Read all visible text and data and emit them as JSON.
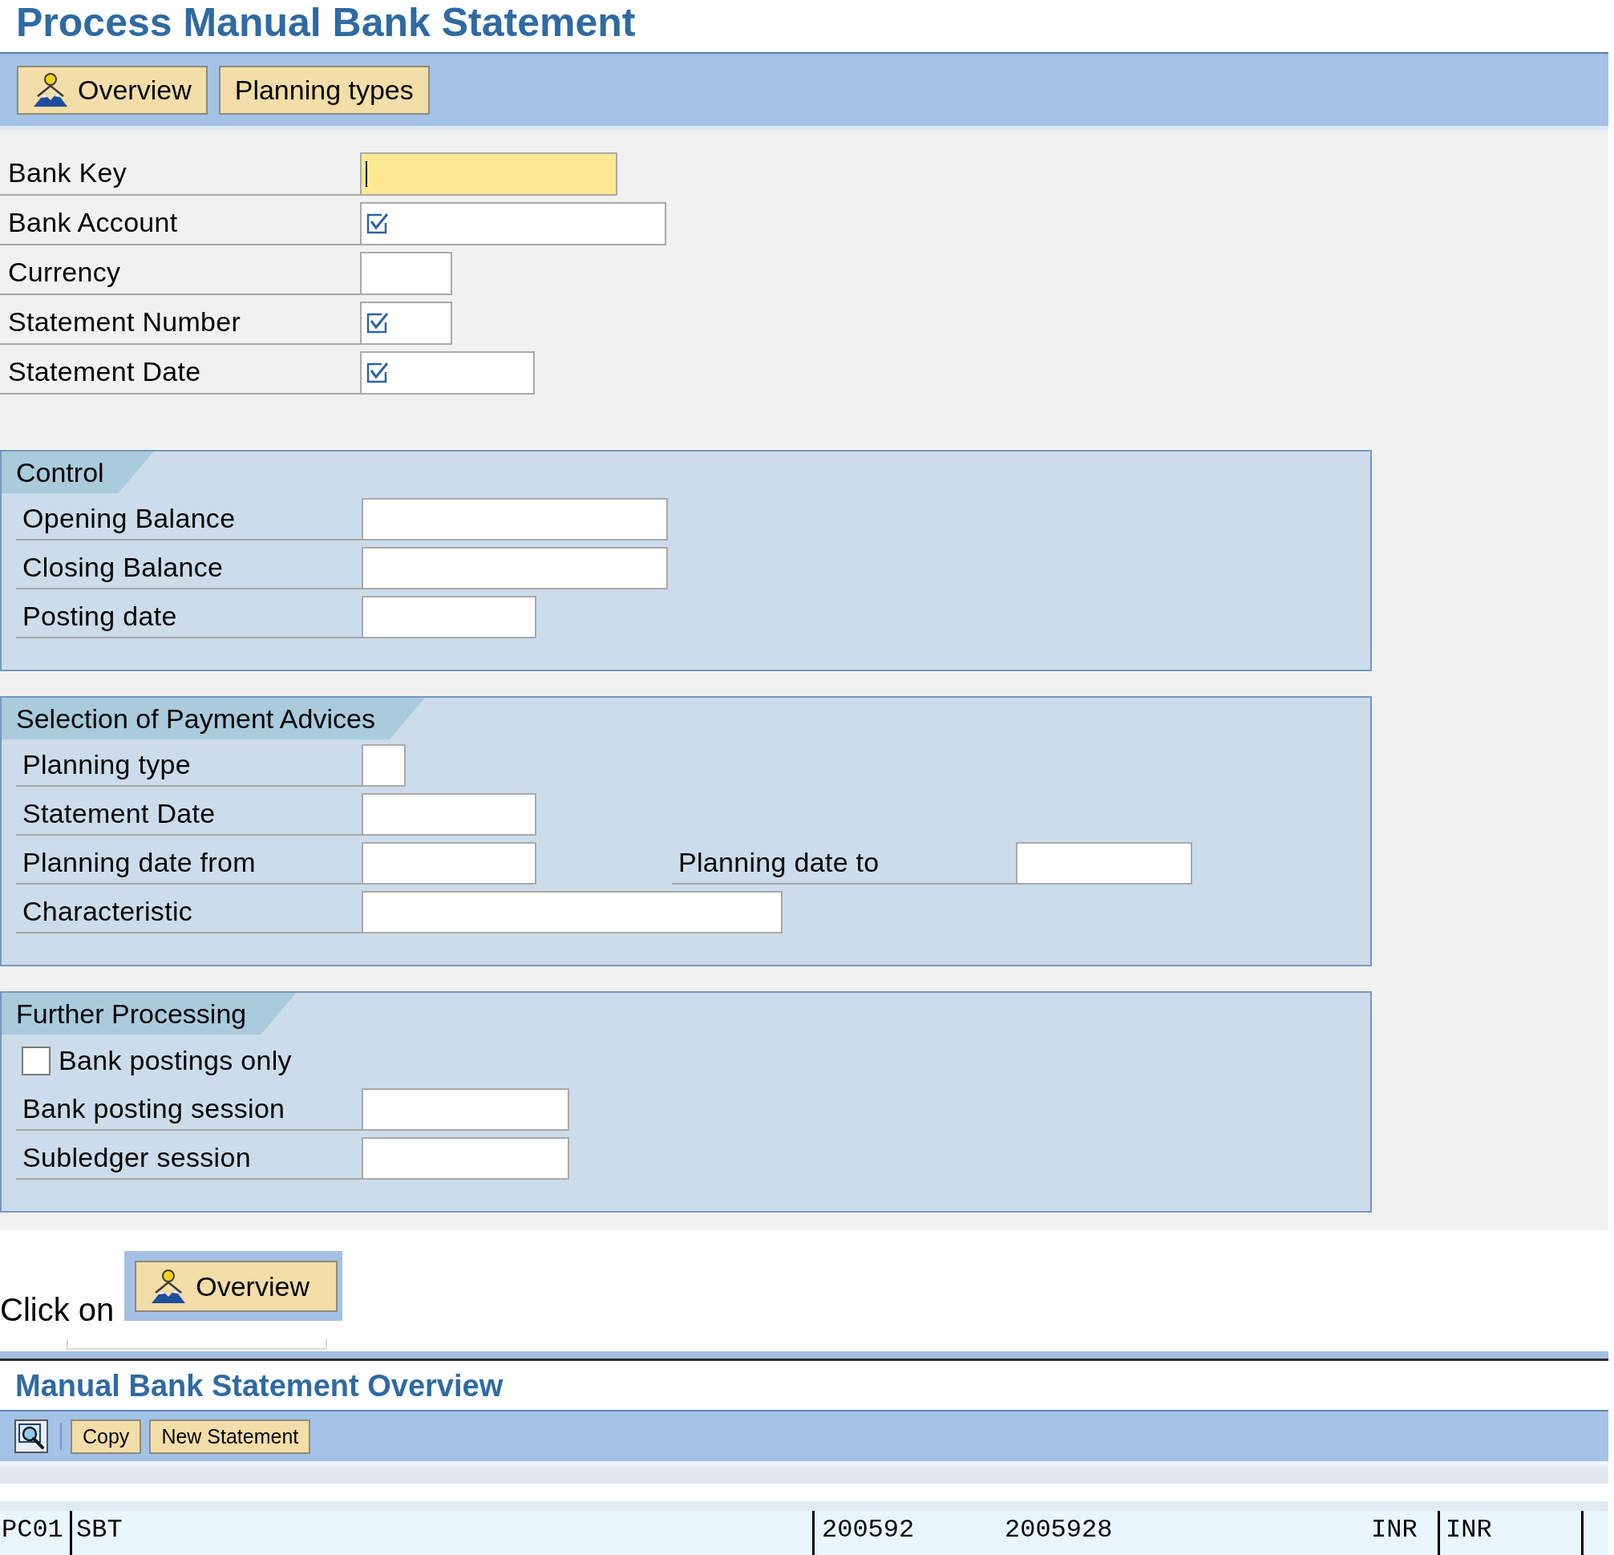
{
  "page_title": "Process Manual Bank Statement",
  "toolbar": [
    {
      "kind": "icon_text",
      "label": "Overview"
    },
    {
      "kind": "text",
      "label": "Planning types"
    }
  ],
  "fields": [
    {
      "label": "Bank Key",
      "focused": true,
      "required": false
    },
    {
      "label": "Bank Account",
      "focused": false,
      "required": true
    },
    {
      "label": "Currency",
      "focused": false,
      "required": false
    },
    {
      "label": "Statement Number",
      "focused": false,
      "required": true
    },
    {
      "label": "Statement Date",
      "focused": false,
      "required": true
    }
  ],
  "groups": [
    {
      "title": "Control",
      "rows": [
        {
          "kind": "field",
          "label": "Opening Balance"
        },
        {
          "kind": "field",
          "label": "Closing Balance"
        },
        {
          "kind": "field",
          "label": "Posting date"
        }
      ]
    },
    {
      "title": "Selection of Payment Advices",
      "rows": [
        {
          "kind": "field",
          "label": "Planning type"
        },
        {
          "kind": "field",
          "label": "Statement Date"
        },
        {
          "kind": "range",
          "label": "Planning date from",
          "to_label": "Planning date to"
        },
        {
          "kind": "field",
          "label": "Characteristic"
        }
      ]
    },
    {
      "title": "Further Processing",
      "rows": [
        {
          "kind": "checkbox",
          "label": "Bank postings only",
          "checked": false
        },
        {
          "kind": "field",
          "label": "Bank posting session"
        },
        {
          "kind": "field",
          "label": "Subledger session"
        }
      ]
    }
  ],
  "instruction": {
    "text": "Click on",
    "button": {
      "kind": "icon_text",
      "label": "Overview"
    }
  },
  "overview": {
    "title": "Manual Bank Statement Overview",
    "toolbar": [
      {
        "kind": "icon"
      },
      {
        "kind": "separator"
      },
      {
        "kind": "text",
        "label": "Copy"
      },
      {
        "kind": "text",
        "label": "New Statement"
      }
    ],
    "rows": [
      {
        "cells": [
          "PC01",
          "SBT",
          "200592",
          "2005928",
          "INR",
          "INR"
        ]
      }
    ]
  }
}
